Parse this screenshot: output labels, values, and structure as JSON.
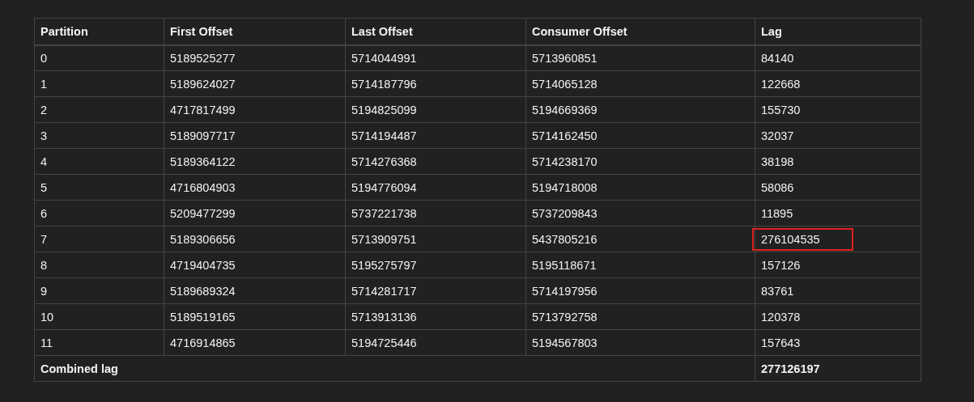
{
  "table": {
    "columns": [
      "Partition",
      "First Offset",
      "Last Offset",
      "Consumer Offset",
      "Lag"
    ],
    "rows": [
      {
        "cells": [
          "0",
          "5189525277",
          "5714044991",
          "5713960851",
          "84140"
        ],
        "highlighted": false
      },
      {
        "cells": [
          "1",
          "5189624027",
          "5714187796",
          "5714065128",
          "122668"
        ],
        "highlighted": false
      },
      {
        "cells": [
          "2",
          "4717817499",
          "5194825099",
          "5194669369",
          "155730"
        ],
        "highlighted": false
      },
      {
        "cells": [
          "3",
          "5189097717",
          "5714194487",
          "5714162450",
          "32037"
        ],
        "highlighted": false
      },
      {
        "cells": [
          "4",
          "5189364122",
          "5714276368",
          "5714238170",
          "38198"
        ],
        "highlighted": false
      },
      {
        "cells": [
          "5",
          "4716804903",
          "5194776094",
          "5194718008",
          "58086"
        ],
        "highlighted": false
      },
      {
        "cells": [
          "6",
          "5209477299",
          "5737221738",
          "5737209843",
          "11895"
        ],
        "highlighted": false
      },
      {
        "cells": [
          "7",
          "5189306656",
          "5713909751",
          "5437805216",
          "276104535"
        ],
        "highlighted": true
      },
      {
        "cells": [
          "8",
          "4719404735",
          "5195275797",
          "5195118671",
          "157126"
        ],
        "highlighted": false
      },
      {
        "cells": [
          "9",
          "5189689324",
          "5714281717",
          "5714197956",
          "83761"
        ],
        "highlighted": false
      },
      {
        "cells": [
          "10",
          "5189519165",
          "5713913136",
          "5713792758",
          "120378"
        ],
        "highlighted": false
      },
      {
        "cells": [
          "11",
          "4716914865",
          "5194725446",
          "5194567803",
          "157643"
        ],
        "highlighted": false
      }
    ],
    "footer": {
      "label": "Combined lag",
      "value": "277126197"
    }
  }
}
